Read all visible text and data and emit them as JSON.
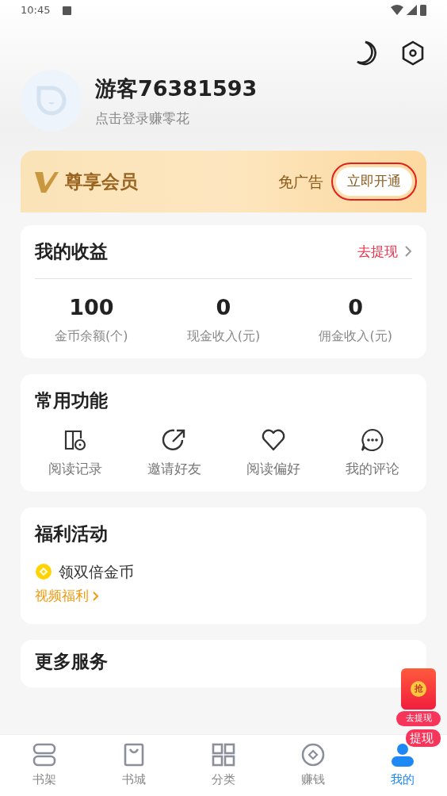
{
  "status_bar": {
    "time": "10:45"
  },
  "profile": {
    "name": "游客76381593",
    "subtitle": "点击登录赚零花"
  },
  "vip": {
    "title": "尊享会员",
    "perk": "免广告",
    "button": "立即开通",
    "highlighted": true
  },
  "earnings": {
    "title": "我的收益",
    "link": "去提现",
    "stats": [
      {
        "value": "100",
        "label": "金币余额(个)"
      },
      {
        "value": "0",
        "label": "现金收入(元)"
      },
      {
        "value": "0",
        "label": "佣金收入(元)"
      }
    ]
  },
  "functions": {
    "title": "常用功能",
    "items": [
      {
        "kind": "history",
        "label": "阅读记录"
      },
      {
        "kind": "invite",
        "label": "邀请好友"
      },
      {
        "kind": "favorite",
        "label": "阅读偏好"
      },
      {
        "kind": "comment",
        "label": "我的评论"
      }
    ]
  },
  "welfare": {
    "title": "福利活动",
    "item": "领双倍金币",
    "link": "视频福利"
  },
  "more": {
    "title": "更多服务"
  },
  "floating_badge": {
    "seal": "抢",
    "tag": "去提现",
    "label": "提现"
  },
  "tabs": [
    {
      "kind": "shelf",
      "label": "书架",
      "selected": false
    },
    {
      "kind": "store",
      "label": "书城",
      "selected": false
    },
    {
      "kind": "category",
      "label": "分类",
      "selected": false
    },
    {
      "kind": "earn",
      "label": "赚钱",
      "selected": false
    },
    {
      "kind": "me",
      "label": "我的",
      "selected": true
    }
  ]
}
